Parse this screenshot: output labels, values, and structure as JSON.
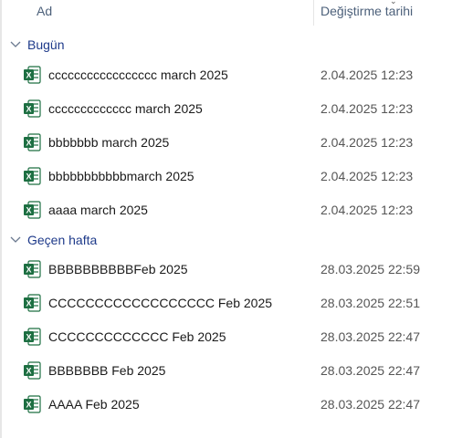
{
  "columns": {
    "name": "Ad",
    "modified": "Değiştirme tarihi"
  },
  "groups": [
    {
      "label": "Bugün",
      "files": [
        {
          "name": "ccccccccccccccccc march 2025",
          "modified": "2.04.2025 12:23",
          "icon": "excel-file-icon"
        },
        {
          "name": "ccccccccccccc march 2025",
          "modified": "2.04.2025 12:23",
          "icon": "excel-file-icon"
        },
        {
          "name": "bbbbbbb march 2025",
          "modified": "2.04.2025 12:23",
          "icon": "excel-file-icon"
        },
        {
          "name": "bbbbbbbbbbbmarch 2025",
          "modified": "2.04.2025 12:23",
          "icon": "excel-file-icon"
        },
        {
          "name": "aaaa march 2025",
          "modified": "2.04.2025 12:23",
          "icon": "excel-file-icon"
        }
      ]
    },
    {
      "label": "Geçen hafta",
      "files": [
        {
          "name": "BBBBBBBBBBFeb 2025",
          "modified": "28.03.2025 22:59",
          "icon": "excel-file-icon"
        },
        {
          "name": "CCCCCCCCCCCCCCCCCC Feb 2025",
          "modified": "28.03.2025 22:51",
          "icon": "excel-file-icon"
        },
        {
          "name": "CCCCCCCCCCCCC Feb 2025",
          "modified": "28.03.2025 22:47",
          "icon": "excel-file-icon"
        },
        {
          "name": "BBBBBBB Feb 2025",
          "modified": "28.03.2025 22:47",
          "icon": "excel-file-icon"
        },
        {
          "name": "AAAA Feb 2025",
          "modified": "28.03.2025 22:47",
          "icon": "excel-file-icon"
        }
      ]
    }
  ],
  "colors": {
    "header_text": "#4c607a",
    "group_text": "#1e3a8a",
    "excel_green": "#1d6f42"
  }
}
